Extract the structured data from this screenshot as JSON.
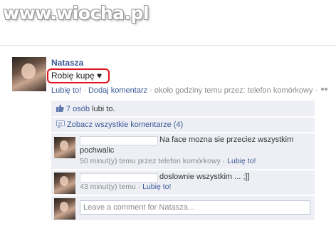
{
  "watermark": "www.wiocha.pl",
  "post": {
    "author": "Natasza",
    "status": "Robię kupę ♥",
    "meta": {
      "like": "Lubię to!",
      "sep1": " · ",
      "comment": "Dodaj komentarz",
      "sep2": " · ",
      "time": "około godziny temu przez: telefon komórkowy",
      "sep3": " · "
    }
  },
  "feedback": {
    "likes": {
      "count_link": "7 osób",
      "suffix": " lubi to."
    },
    "view_all": "Zobacz wszystkie komentarze (4)",
    "comments": [
      {
        "text_line1": "Na face mozna sie przeciez wszystkim",
        "text_line2": "pochwalic",
        "meta_time": "50 minut(y) temu przez telefon komórkowy",
        "sep": " · ",
        "like": "Lubię to!"
      },
      {
        "text": "doslownie wszystkim ... ;]]",
        "meta_time": "43 minut(y) temu",
        "sep": " · ",
        "like": "Lubię to!"
      }
    ],
    "input_placeholder": "Leave a comment for Natasza..."
  },
  "colors": {
    "link": "#3b5998",
    "highlight": "#e0141e",
    "row_bg": "#edeff4"
  }
}
